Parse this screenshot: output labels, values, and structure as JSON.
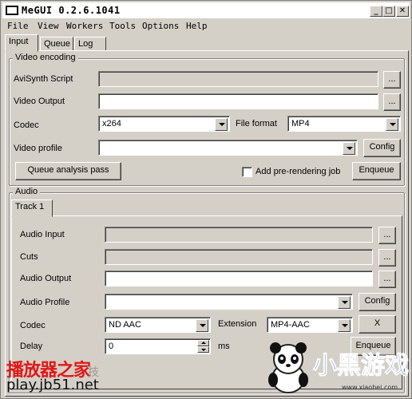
{
  "window": {
    "title": "MeGUI 0.2.6.1041",
    "minimize": "_",
    "maximize": "□",
    "close": "✕"
  },
  "menu": [
    "File",
    "View",
    "Workers",
    "Tools",
    "Options",
    "Help"
  ],
  "tabs": [
    "Input",
    "Queue",
    "Log"
  ],
  "video": {
    "group_title": "Video encoding",
    "avisynth_label": "AviSynth Script",
    "avisynth_value": "",
    "output_label": "Video Output",
    "output_value": "",
    "browse": "...",
    "codec_label": "Codec",
    "codec_value": "x264",
    "format_label": "File format",
    "format_value": "MP4",
    "profile_label": "Video profile",
    "profile_value": "",
    "config_button": "Config",
    "queue_analysis_button": "Queue analysis pass",
    "prerender_label": "Add pre-rendering job",
    "prerender_checked": false,
    "enqueue_button": "Enqueue"
  },
  "audio": {
    "group_title": "Audio",
    "track_tab": "Track 1",
    "input_label": "Audio Input",
    "input_value": "",
    "cuts_label": "Cuts",
    "cuts_value": "",
    "output_label": "Audio Output",
    "output_value": "",
    "browse": "...",
    "profile_label": "Audio Profile",
    "profile_value": "",
    "config_button": "Config",
    "codec_label": "Codec",
    "codec_value": "ND AAC",
    "extension_label": "Extension",
    "extension_value": "MP4-AAC",
    "remove_button": "X",
    "delay_label": "Delay",
    "delay_value": "0",
    "delay_unit": "ms",
    "enqueue_button": "Enqueue"
  },
  "watermarks": {
    "site_logo": "播放器之家",
    "site_url": "play.jb51.net",
    "site_extra": "技",
    "brand_logo": "小黑游戏",
    "brand_url": "www.xiaohei.com",
    "colors": {
      "red": "#e01818",
      "blue": "#1a5fd0"
    }
  }
}
